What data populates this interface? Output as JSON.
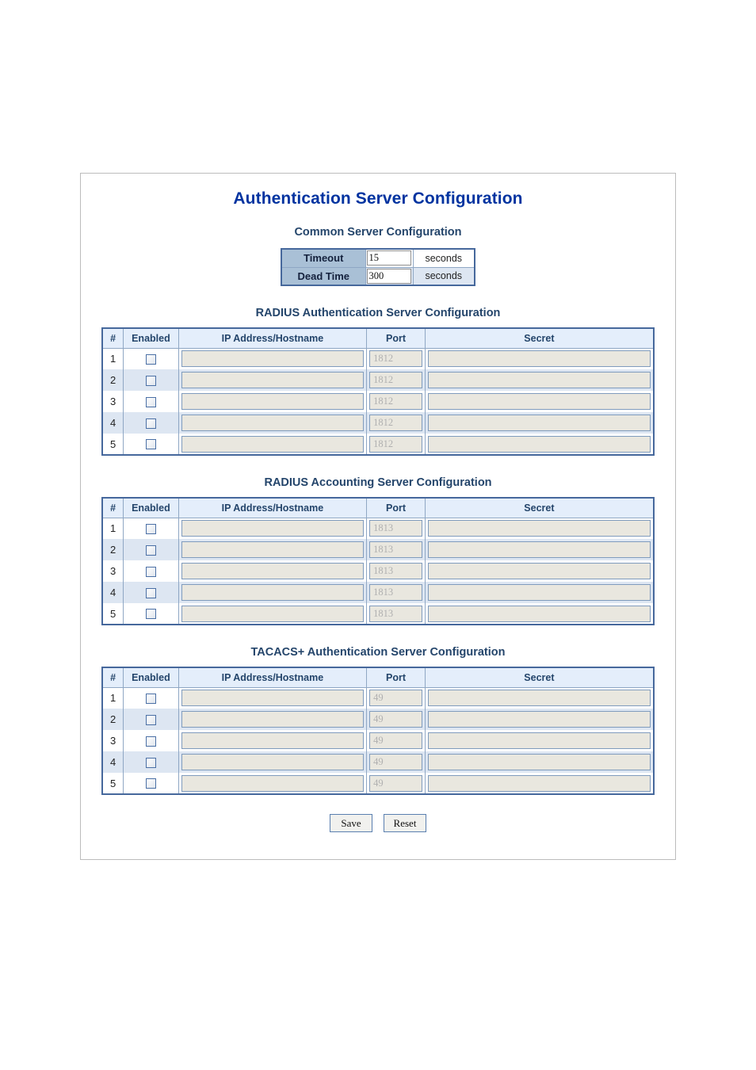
{
  "page": {
    "title": "Authentication Server Configuration"
  },
  "common": {
    "section_title": "Common Server Configuration",
    "rows": [
      {
        "label": "Timeout",
        "value": "15",
        "unit": "seconds"
      },
      {
        "label": "Dead Time",
        "value": "300",
        "unit": "seconds"
      }
    ]
  },
  "columns": {
    "num": "#",
    "enabled": "Enabled",
    "ip": "IP Address/Hostname",
    "port": "Port",
    "secret": "Secret"
  },
  "radius_auth": {
    "section_title": "RADIUS Authentication Server Configuration",
    "rows": [
      {
        "num": "1",
        "enabled": false,
        "ip": "",
        "port": "1812",
        "secret": ""
      },
      {
        "num": "2",
        "enabled": false,
        "ip": "",
        "port": "1812",
        "secret": ""
      },
      {
        "num": "3",
        "enabled": false,
        "ip": "",
        "port": "1812",
        "secret": ""
      },
      {
        "num": "4",
        "enabled": false,
        "ip": "",
        "port": "1812",
        "secret": ""
      },
      {
        "num": "5",
        "enabled": false,
        "ip": "",
        "port": "1812",
        "secret": ""
      }
    ]
  },
  "radius_acct": {
    "section_title": "RADIUS Accounting Server Configuration",
    "rows": [
      {
        "num": "1",
        "enabled": false,
        "ip": "",
        "port": "1813",
        "secret": ""
      },
      {
        "num": "2",
        "enabled": false,
        "ip": "",
        "port": "1813",
        "secret": ""
      },
      {
        "num": "3",
        "enabled": false,
        "ip": "",
        "port": "1813",
        "secret": ""
      },
      {
        "num": "4",
        "enabled": false,
        "ip": "",
        "port": "1813",
        "secret": ""
      },
      {
        "num": "5",
        "enabled": false,
        "ip": "",
        "port": "1813",
        "secret": ""
      }
    ]
  },
  "tacacs": {
    "section_title": "TACACS+ Authentication Server Configuration",
    "rows": [
      {
        "num": "1",
        "enabled": false,
        "ip": "",
        "port": "49",
        "secret": ""
      },
      {
        "num": "2",
        "enabled": false,
        "ip": "",
        "port": "49",
        "secret": ""
      },
      {
        "num": "3",
        "enabled": false,
        "ip": "",
        "port": "49",
        "secret": ""
      },
      {
        "num": "4",
        "enabled": false,
        "ip": "",
        "port": "49",
        "secret": ""
      },
      {
        "num": "5",
        "enabled": false,
        "ip": "",
        "port": "49",
        "secret": ""
      }
    ]
  },
  "actions": {
    "save_label": "Save",
    "reset_label": "Reset"
  },
  "colors": {
    "title_blue": "#0033a0",
    "section_navy": "#24456b",
    "table_border": "#46689c",
    "header_bg": "#e4eefb",
    "stripe_bg": "#dde6f2",
    "label_bg": "#a9c0d6",
    "input_bg": "#e9e7df"
  }
}
